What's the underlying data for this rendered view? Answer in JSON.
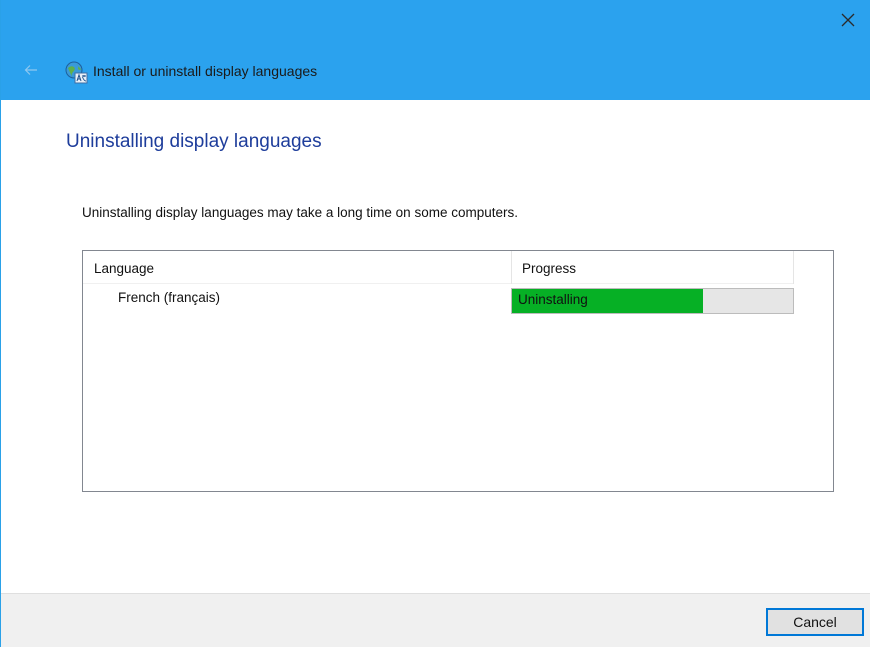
{
  "window": {
    "title": "Install or uninstall display languages",
    "icon": "language-globe-icon",
    "accent_color": "#2ba2ee"
  },
  "content": {
    "heading": "Uninstalling display languages",
    "description": "Uninstalling display languages may take a long time on some computers."
  },
  "list": {
    "columns": [
      {
        "label": "Language"
      },
      {
        "label": "Progress"
      }
    ],
    "rows": [
      {
        "language": "French (français)",
        "status": "Uninstalling",
        "progress_percent": 68,
        "progress_color": "#06b025"
      }
    ]
  },
  "footer": {
    "cancel_label": "Cancel"
  }
}
